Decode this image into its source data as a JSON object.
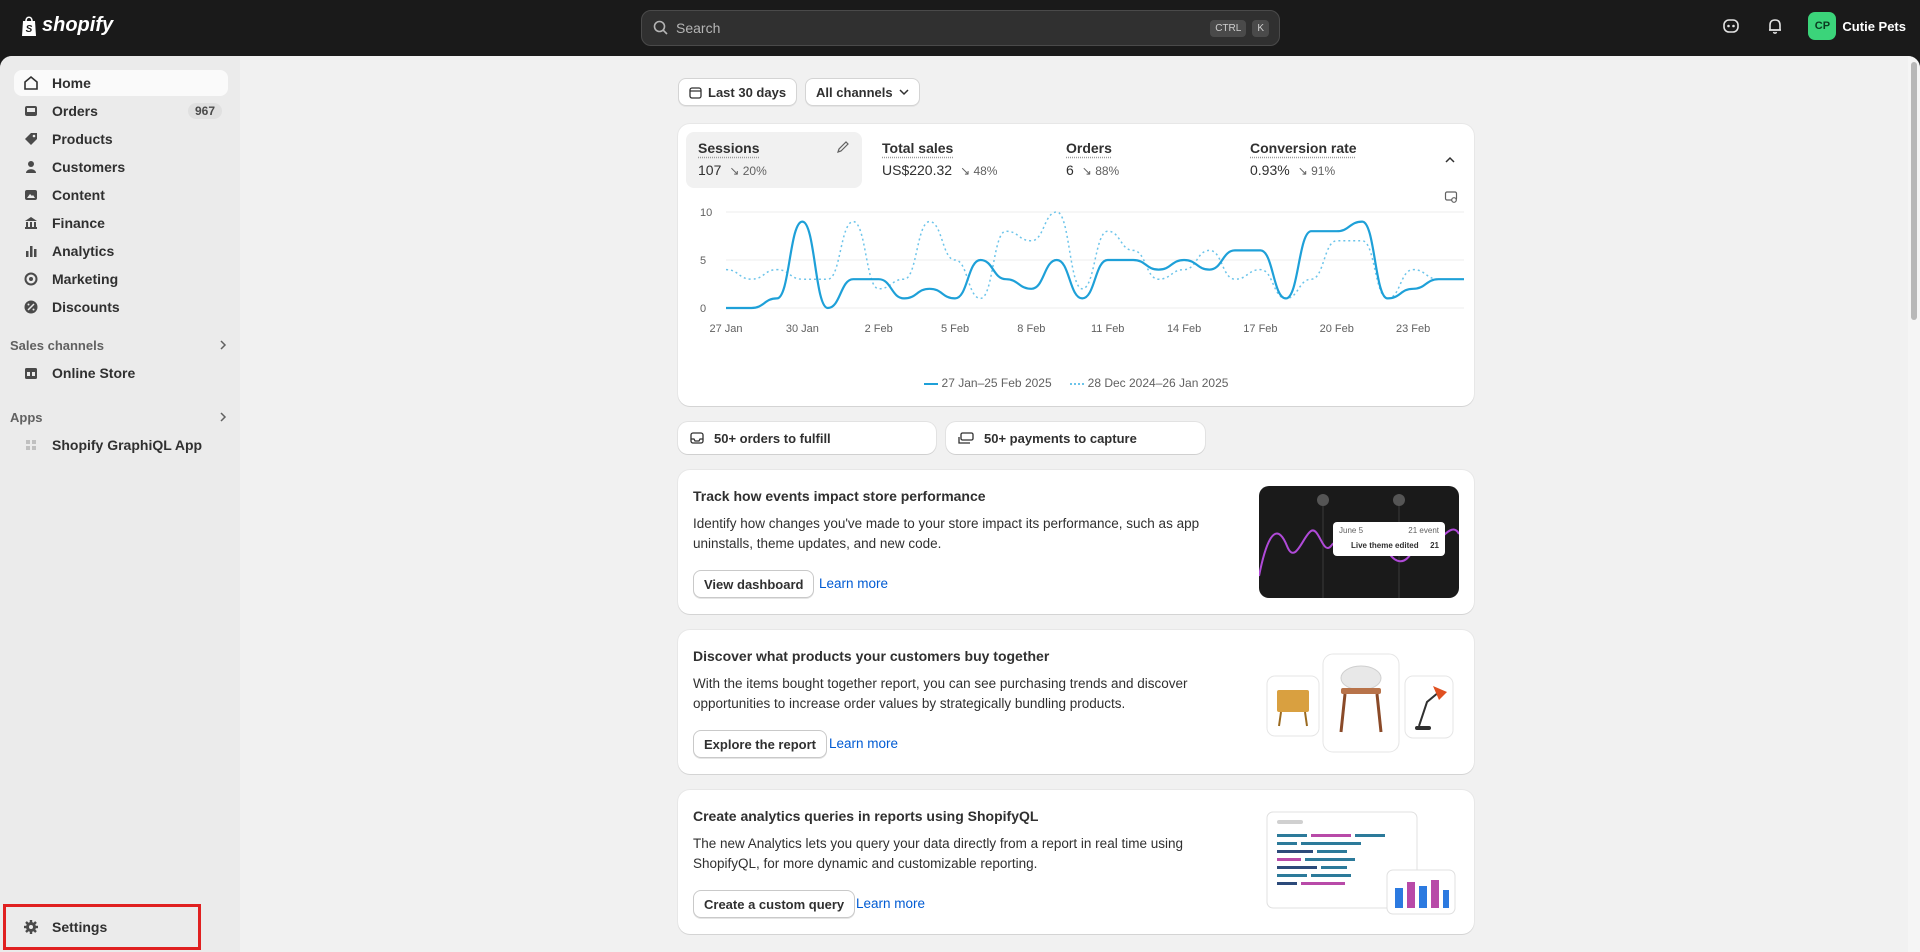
{
  "topbar": {
    "brand": "shopify",
    "search_placeholder": "Search",
    "shortcut_ctrl": "CTRL",
    "shortcut_key": "K",
    "store_initials": "CP",
    "store_name": "Cutie Pets"
  },
  "sidebar": {
    "items": [
      {
        "label": "Home",
        "icon": "home-icon"
      },
      {
        "label": "Orders",
        "icon": "inbox-icon",
        "badge": "967"
      },
      {
        "label": "Products",
        "icon": "tag-icon"
      },
      {
        "label": "Customers",
        "icon": "person-icon"
      },
      {
        "label": "Content",
        "icon": "image-icon"
      },
      {
        "label": "Finance",
        "icon": "bank-icon"
      },
      {
        "label": "Analytics",
        "icon": "bar-chart-icon"
      },
      {
        "label": "Marketing",
        "icon": "target-icon"
      },
      {
        "label": "Discounts",
        "icon": "discount-icon"
      }
    ],
    "sales_channels_label": "Sales channels",
    "online_store": "Online Store",
    "apps_label": "Apps",
    "app_item": "Shopify GraphiQL App",
    "settings": "Settings"
  },
  "filters": {
    "date_range": "Last 30 days",
    "channels": "All channels"
  },
  "metrics": [
    {
      "label": "Sessions",
      "value": "107",
      "delta": "20%"
    },
    {
      "label": "Total sales",
      "value": "US$220.32",
      "delta": "48%"
    },
    {
      "label": "Orders",
      "value": "6",
      "delta": "88%"
    },
    {
      "label": "Conversion rate",
      "value": "0.93%",
      "delta": "91%"
    }
  ],
  "chart_data": {
    "type": "line",
    "x_ticks": [
      "27 Jan",
      "30 Jan",
      "2 Feb",
      "5 Feb",
      "8 Feb",
      "11 Feb",
      "14 Feb",
      "17 Feb",
      "20 Feb",
      "23 Feb"
    ],
    "y_ticks": [
      "0",
      "5",
      "10"
    ],
    "ylim": [
      0,
      10
    ],
    "series": [
      {
        "name": "27 Jan–25 Feb 2025",
        "style": "solid",
        "color": "#1ea0d8",
        "values": [
          0,
          0,
          1,
          9,
          0,
          3,
          3,
          1,
          2,
          1,
          5,
          3,
          2,
          5,
          1,
          5,
          5,
          4,
          5,
          4,
          6,
          6,
          1,
          8,
          8,
          9,
          1,
          2,
          3,
          3
        ]
      },
      {
        "name": "28 Dec 2024–26 Jan 2025",
        "style": "dotted",
        "color": "#6cc4ea",
        "values": [
          4,
          3,
          4,
          3,
          3,
          9,
          2,
          3,
          9,
          5,
          1,
          8,
          7,
          10,
          2,
          8,
          6,
          3,
          4,
          6,
          3,
          4,
          1,
          3,
          7,
          7,
          1,
          4,
          3,
          3
        ]
      }
    ]
  },
  "tasks": [
    {
      "label": "50+ orders to fulfill",
      "icon": "inbox-icon"
    },
    {
      "label": "50+ payments to capture",
      "icon": "cash-icon"
    }
  ],
  "promos": [
    {
      "title": "Track how events impact store performance",
      "body": "Identify how changes you've made to your store impact its performance, such as app uninstalls, theme updates, and new code.",
      "button": "View dashboard",
      "link": "Learn more",
      "illus_date": "June 5",
      "illus_count": "21 event",
      "illus_label": "Live theme edited",
      "illus_value": "21"
    },
    {
      "title": "Discover what products your customers buy together",
      "body": "With the items bought together report, you can see purchasing trends and discover opportunities to increase order values by strategically bundling products.",
      "button": "Explore the report",
      "link": "Learn more"
    },
    {
      "title": "Create analytics queries in reports using ShopifyQL",
      "body": "The new Analytics lets you query your data directly from a report in real time using ShopifyQL, for more dynamic and customizable reporting.",
      "button": "Create a custom query",
      "link": "Learn more"
    }
  ]
}
